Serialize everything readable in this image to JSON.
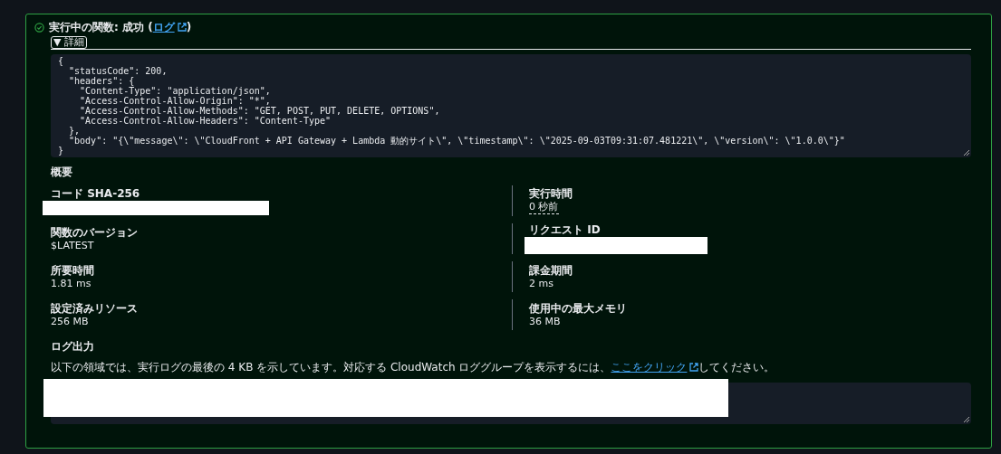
{
  "status": {
    "success": true,
    "label": "実行中の関数: 成功 (",
    "link": "ログ",
    "suffix": ")"
  },
  "details_toggle": {
    "icon": "▼",
    "label": "詳細",
    "expanded": true
  },
  "response": {
    "lines": [
      "{",
      "  \"statusCode\": 200,",
      "  \"headers\": {",
      "    \"Content-Type\": \"application/json\",",
      "    \"Access-Control-Allow-Origin\": \"*\",",
      "    \"Access-Control-Allow-Methods\": \"GET, POST, PUT, DELETE, OPTIONS\",",
      "    \"Access-Control-Allow-Headers\": \"Content-Type\"",
      "  },",
      "  \"body\": \"{\\\"message\\\": \\\"CloudFront + API Gateway + Lambda 動的サイト\\\", \\\"timestamp\\\": \\\"2025-09-03T09:31:07.481221\\\", \\\"version\\\": \\\"1.0.0\\\"}\"",
      "}"
    ]
  },
  "summary": {
    "title": "概要",
    "columns": [
      [
        {
          "label": "コード SHA-256",
          "kind": "redacted"
        },
        {
          "label": "関数のバージョン",
          "kind": "text",
          "value": "$LATEST"
        },
        {
          "label": "所要時間",
          "kind": "text",
          "value": "1.81 ms"
        },
        {
          "label": "設定済みリソース",
          "kind": "text",
          "value": "256 MB"
        }
      ],
      [
        {
          "label": "実行時間",
          "kind": "relative-time",
          "value": "0 秒前"
        },
        {
          "label": "リクエスト ID",
          "kind": "redacted"
        },
        {
          "label": "課金期間",
          "kind": "text",
          "value": "2 ms"
        },
        {
          "label": "使用中の最大メモリ",
          "kind": "text",
          "value": "36 MB"
        }
      ]
    ]
  },
  "log_output": {
    "title": "ログ出力",
    "description": "以下の領域では、実行ログの最後の 4 KB を示しています。対応する CloudWatch ロググループを表示するには、",
    "link": "ここをクリック",
    "suffix": "してください。",
    "output": {
      "kind": "redacted"
    }
  }
}
